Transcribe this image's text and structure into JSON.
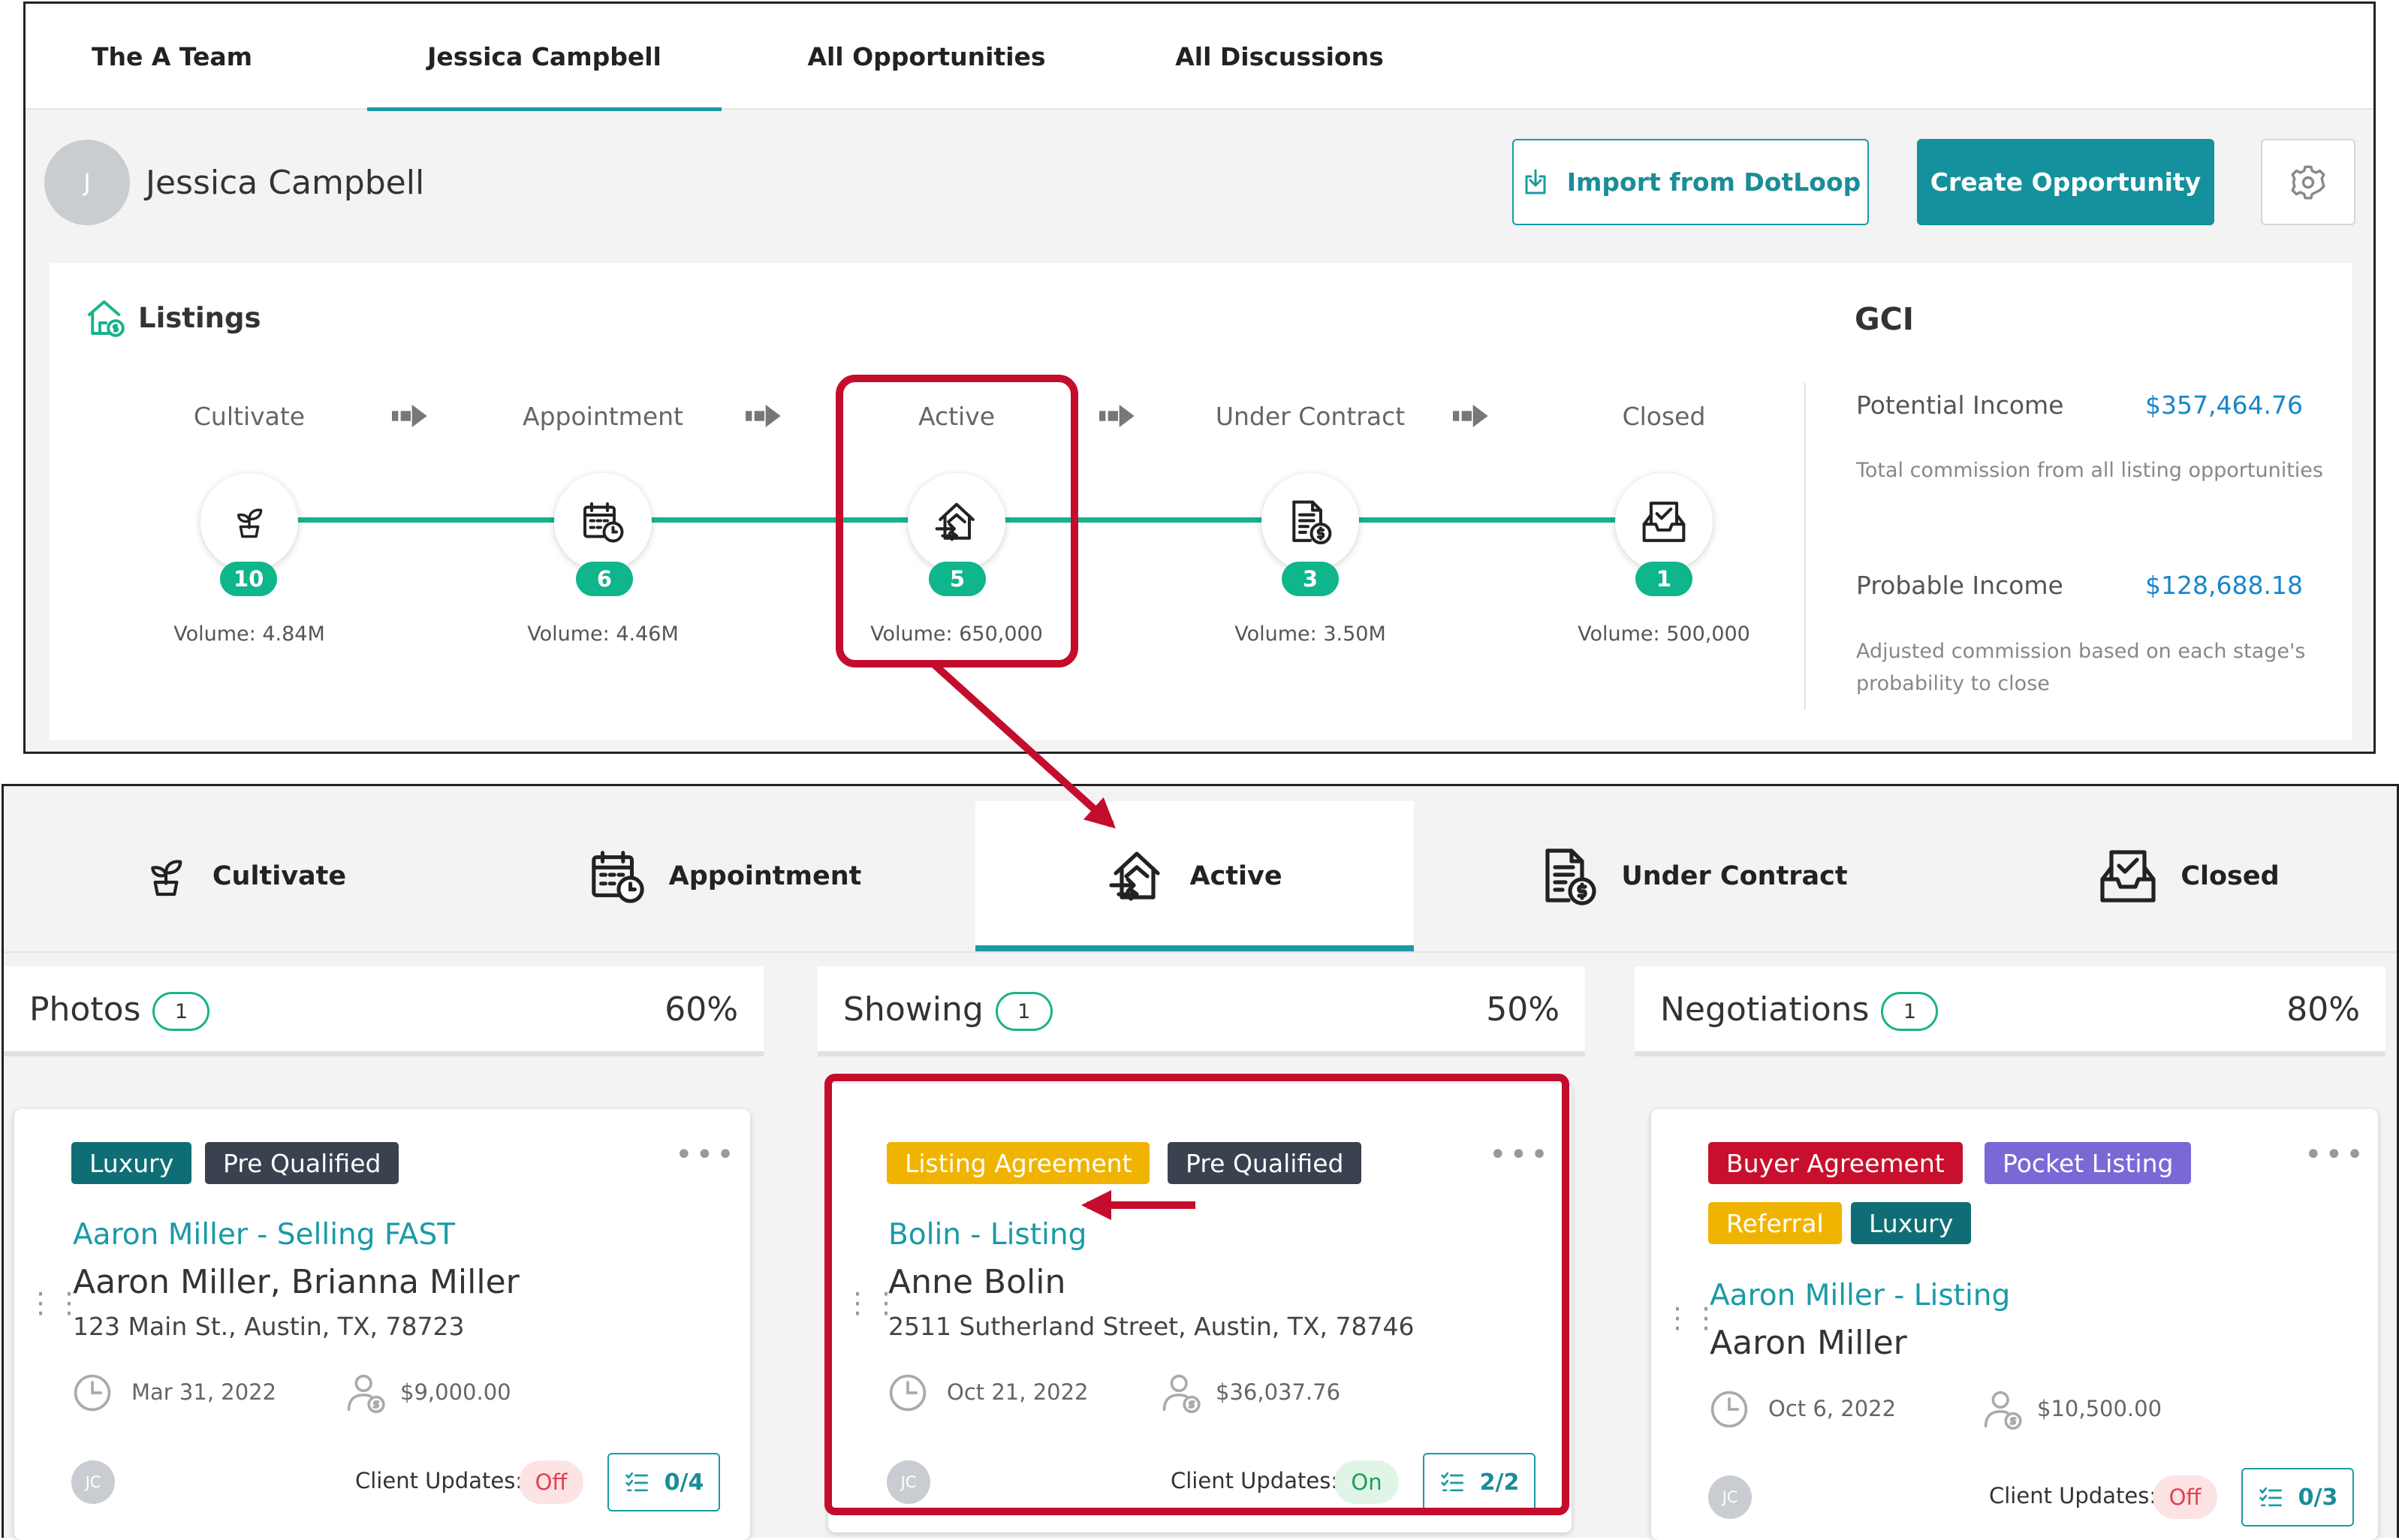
{
  "top_tabs": [
    "The A Team",
    "Jessica Campbell",
    "All Opportunities",
    "All Discussions"
  ],
  "user": {
    "initial": "J",
    "name": "Jessica Campbell"
  },
  "buttons": {
    "import": "Import from DotLoop",
    "create": "Create Opportunity"
  },
  "listings": {
    "title": "Listings",
    "stages": [
      {
        "label": "Cultivate",
        "count": "10",
        "volume": "Volume: 4.84M",
        "icon": "sprout-icon"
      },
      {
        "label": "Appointment",
        "count": "6",
        "volume": "Volume: 4.46M",
        "icon": "calendar-clock-icon"
      },
      {
        "label": "Active",
        "count": "5",
        "volume": "Volume: 650,000",
        "icon": "house-arrow-icon"
      },
      {
        "label": "Under Contract",
        "count": "3",
        "volume": "Volume: 3.50M",
        "icon": "document-dollar-icon"
      },
      {
        "label": "Closed",
        "count": "1",
        "volume": "Volume: 500,000",
        "icon": "inbox-check-icon"
      }
    ]
  },
  "gci": {
    "title": "GCI",
    "potential_label": "Potential Income",
    "potential_value": "$357,464.76",
    "potential_desc": "Total commission from all listing opportunities",
    "probable_label": "Probable Income",
    "probable_value": "$128,688.18",
    "probable_desc": "Adjusted commission based on each stage's probability to close"
  },
  "stage_tabs": [
    {
      "label": "Cultivate",
      "icon": "sprout-icon"
    },
    {
      "label": "Appointment",
      "icon": "calendar-clock-icon"
    },
    {
      "label": "Active",
      "icon": "house-arrow-icon",
      "active": true
    },
    {
      "label": "Under Contract",
      "icon": "document-dollar-icon"
    },
    {
      "label": "Closed",
      "icon": "inbox-check-icon"
    }
  ],
  "columns": [
    {
      "title": "Photos",
      "count": "1",
      "percent": "60%",
      "card": {
        "tags": [
          {
            "text": "Luxury",
            "color": "#0f6e75"
          },
          {
            "text": "Pre Qualified",
            "color": "#3a4250"
          }
        ],
        "title": "Aaron Miller - Selling FAST",
        "name": "Aaron Miller, Brianna Miller",
        "address": "123 Main St., Austin, TX, 78723",
        "date": "Mar 31, 2022",
        "amount": "$9,000.00",
        "initials": "JC",
        "client_updates_label": "Client Updates:",
        "client_updates": "Off",
        "tasks": "0/4"
      }
    },
    {
      "title": "Showing",
      "count": "1",
      "percent": "50%",
      "card": {
        "tags": [
          {
            "text": "Listing Agreement",
            "color": "#f0b400"
          },
          {
            "text": "Pre Qualified",
            "color": "#3a4250"
          }
        ],
        "title": "Bolin - Listing",
        "name": "Anne Bolin",
        "address": "2511 Sutherland Street, Austin, TX, 78746",
        "date": "Oct 21, 2022",
        "amount": "$36,037.76",
        "initials": "JC",
        "client_updates_label": "Client Updates:",
        "client_updates": "On",
        "tasks": "2/2"
      }
    },
    {
      "title": "Negotiations",
      "count": "1",
      "percent": "80%",
      "card": {
        "tags": [
          {
            "text": "Buyer Agreement",
            "color": "#c8102e"
          },
          {
            "text": "Pocket Listing",
            "color": "#7b68d6"
          },
          {
            "text": "Referral",
            "color": "#f0b400"
          },
          {
            "text": "Luxury",
            "color": "#0f6e75"
          }
        ],
        "title": "Aaron Miller - Listing",
        "name": "Aaron Miller",
        "date": "Oct 6, 2022",
        "amount": "$10,500.00",
        "initials": "JC",
        "client_updates_label": "Client Updates:",
        "client_updates": "Off",
        "tasks": "0/3"
      }
    }
  ],
  "annotation_color": "#c40d2c"
}
